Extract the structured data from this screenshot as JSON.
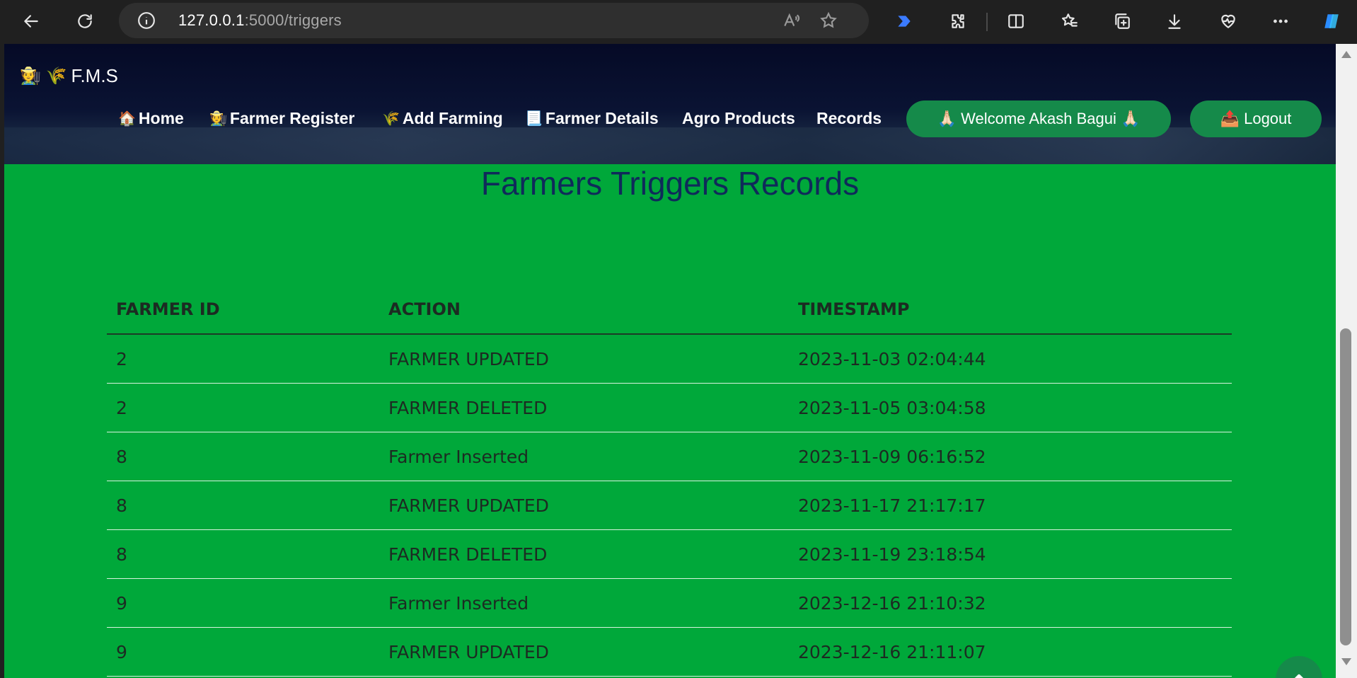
{
  "browser": {
    "url_host": "127.0.0.1",
    "url_rest": ":5000/triggers"
  },
  "navbar": {
    "brand_icons": "🧑‍🌾 🌾",
    "brand": "F.M.S",
    "items": [
      {
        "icon": "🏠",
        "label": "Home"
      },
      {
        "icon": "🧑‍🌾",
        "label": "Farmer Register"
      },
      {
        "icon": "🌾",
        "label": "Add Farming"
      },
      {
        "icon": "📃",
        "label": "Farmer Details"
      },
      {
        "icon": "",
        "label": "Agro Products"
      },
      {
        "icon": "",
        "label": "Records"
      }
    ],
    "welcome": "🙏🏻 Welcome Akash Bagui 🙏🏻",
    "logout": "📤 Logout"
  },
  "page": {
    "title": "Farmers Triggers Records"
  },
  "table": {
    "headers": [
      "Farmer ID",
      "Action",
      "Timestamp"
    ],
    "rows": [
      [
        "2",
        "FARMER UPDATED",
        "2023-11-03 02:04:44"
      ],
      [
        "2",
        "FARMER DELETED",
        "2023-11-05 03:04:58"
      ],
      [
        "8",
        "Farmer Inserted",
        "2023-11-09 06:16:52"
      ],
      [
        "8",
        "FARMER UPDATED",
        "2023-11-17 21:17:17"
      ],
      [
        "8",
        "FARMER DELETED",
        "2023-11-19 23:18:54"
      ],
      [
        "9",
        "Farmer Inserted",
        "2023-12-16 21:10:32"
      ],
      [
        "9",
        "FARMER UPDATED",
        "2023-12-16 21:11:07"
      ]
    ]
  },
  "colors": {
    "page_bg": "#00a83a",
    "navbar_bg": "#050a26",
    "accent_button": "#158a4a",
    "title_color": "#0f2a5a"
  }
}
